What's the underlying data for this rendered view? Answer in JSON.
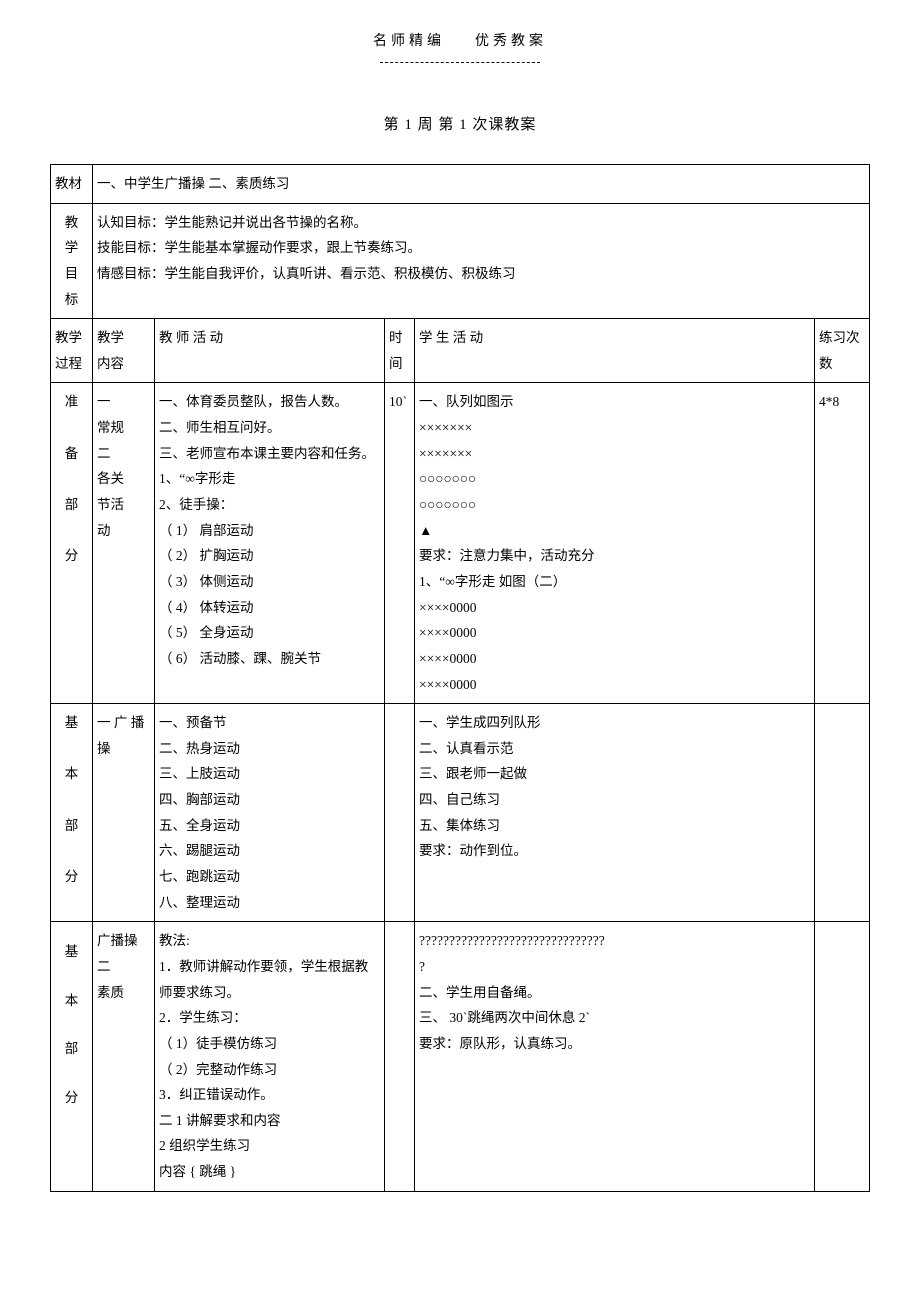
{
  "header": {
    "left": "名师精编",
    "right": "优秀教案"
  },
  "title": "第  1 周  第 1 次课教案",
  "row_material": {
    "label": "教材",
    "text": "一、中学生广播操     二、素质练习"
  },
  "row_goals": {
    "label_lines": [
      "教",
      "学",
      "目",
      "标"
    ],
    "lines": [
      "认知目标：学生能熟记并说出各节操的名称。",
      "技能目标：学生能基本掌握动作要求，跟上节奏练习。",
      "情感目标：学生能自我评价，认真听讲、看示范、积极模仿、积极练习"
    ]
  },
  "row_header": {
    "proc": "教学\n过程",
    "content": "教学\n内容",
    "teacher": "教 师 活 动",
    "time": "时\n间",
    "student": "学 生 活 动",
    "reps": "练习次\n数"
  },
  "prep": {
    "proc_lines": [
      "准",
      "备",
      "部",
      "分"
    ],
    "content": "一\n常规\n二\n各关\n节活\n动",
    "teacher": "一、体育委员整队，报告人数。\n二、师生相互问好。\n三、老师宣布本课主要内容和任务。\n1、“∞字形走\n2、徒手操：\n（ 1）  肩部运动\n（ 2）  扩胸运动\n（ 3）  体侧运动\n（ 4）  体转运动\n（ 5）  全身运动\n（ 6）  活动膝、踝、腕关节",
    "time": "10`",
    "student": "一、队列如图示\n×××××××\n×××××××\n○○○○○○○\n○○○○○○○\n▲\n要求：注意力集中，活动充分\n1、“∞字形走   如图（二）\n××××0000\n××××0000\n××××0000\n××××0000",
    "reps": "4*8"
  },
  "basic1": {
    "proc_lines": [
      "基",
      "本",
      "部",
      "分"
    ],
    "content": "一 广 播操",
    "teacher": "一、预备节\n二、热身运动\n三、上肢运动\n四、胸部运动\n五、全身运动\n六、踢腿运动\n七、跑跳运动\n八、整理运动",
    "time": "",
    "student": "一、学生成四列队形\n二、认真看示范\n三、跟老师一起做\n四、自己练习\n五、集体练习\n要求：动作到位。",
    "reps": ""
  },
  "basic2": {
    "proc_lines": [
      "基",
      "本",
      "部",
      "分"
    ],
    "content": "广播操\n二\n素质",
    "teacher": "教法:\n1．教师讲解动作要领，学生根据教师要求练习。\n2．学生练习：\n（ 1）徒手模仿练习\n（ 2）完整动作练习\n3．纠正错误动作。\n二  1 讲解要求和内容\n2 组织学生练习\n内容 { 跳绳 }",
    "time": "",
    "student": "???????????????????????????????\n?\n二、学生用自备绳。\n三、 30`跳绳两次中间休息    2`\n要求：原队形，认真练习。",
    "reps": ""
  }
}
